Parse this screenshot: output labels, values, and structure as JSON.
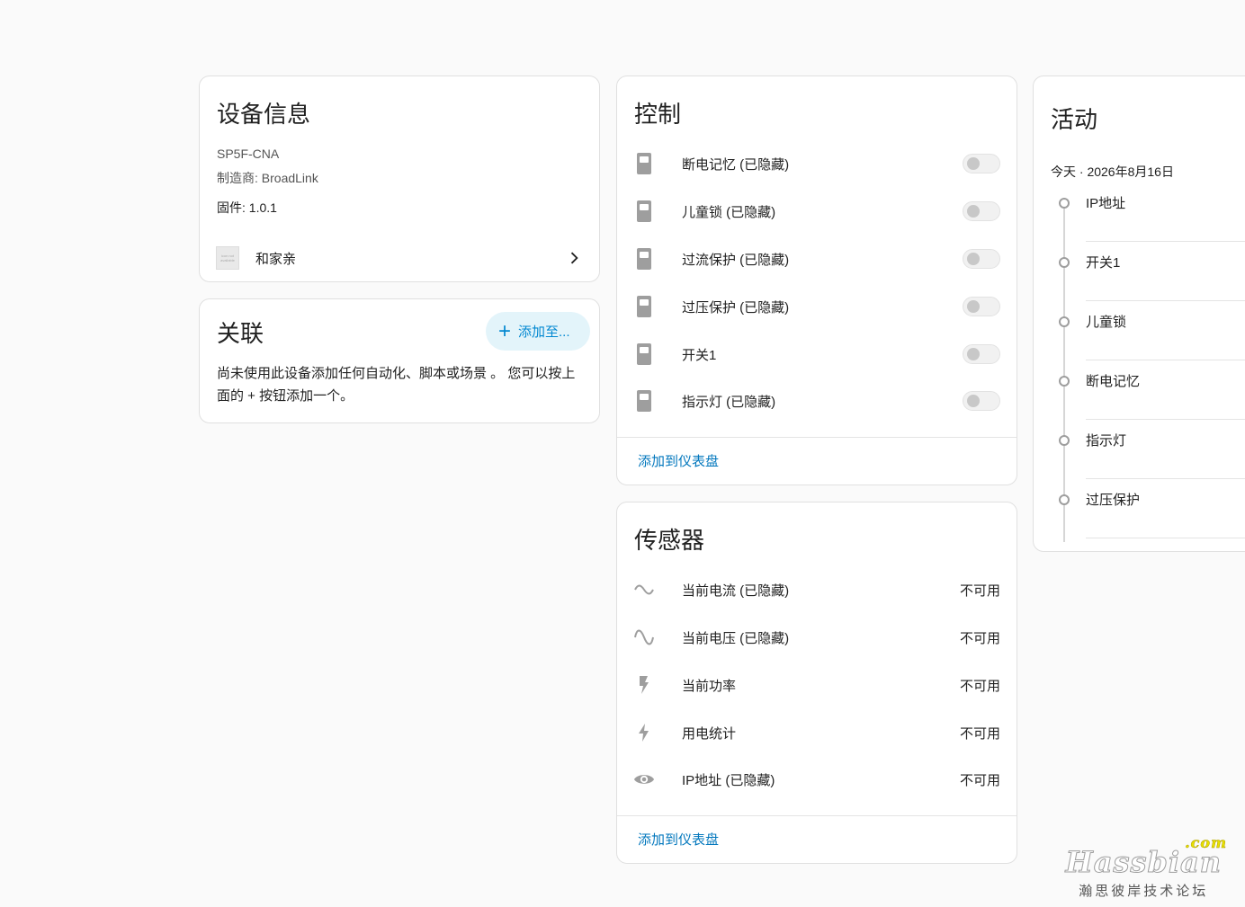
{
  "device_info": {
    "title": "设备信息",
    "model": "SP5F-CNA",
    "manufacturer": "制造商: BroadLink",
    "firmware": "固件: 1.0.1",
    "area_thumb_text": "icon not available",
    "area": "和家亲"
  },
  "related": {
    "title": "关联",
    "add_button": "添加至...",
    "text": "尚未使用此设备添加任何自动化、脚本或场景 。 您可以按上面的 + 按钮添加一个。"
  },
  "controls": {
    "title": "控制",
    "items": [
      {
        "name": "断电记忆 (已隐藏)"
      },
      {
        "name": "儿童锁 (已隐藏)"
      },
      {
        "name": "过流保护 (已隐藏)"
      },
      {
        "name": "过压保护 (已隐藏)"
      },
      {
        "name": "开关1"
      },
      {
        "name": "指示灯 (已隐藏)"
      }
    ],
    "footer_link": "添加到仪表盘"
  },
  "sensors": {
    "title": "传感器",
    "items": [
      {
        "name": "当前电流 (已隐藏)",
        "state": "不可用",
        "icon": "current-ac-icon"
      },
      {
        "name": "当前电压 (已隐藏)",
        "state": "不可用",
        "icon": "sine-wave-icon"
      },
      {
        "name": "当前功率",
        "state": "不可用",
        "icon": "flash-icon"
      },
      {
        "name": "用电统计",
        "state": "不可用",
        "icon": "lightning-bolt-icon"
      },
      {
        "name": "IP地址 (已隐藏)",
        "state": "不可用",
        "icon": "eye-icon"
      }
    ],
    "footer_link": "添加到仪表盘"
  },
  "activity": {
    "title": "活动",
    "date": "今天 · 2026年8月16日",
    "items": [
      "IP地址",
      "开关1",
      "儿童锁",
      "断电记忆",
      "指示灯",
      "过压保护"
    ]
  },
  "watermark": {
    "main": "Hassbian",
    "com": ".com",
    "sub": "瀚思彼岸技术论坛"
  },
  "colors": {
    "accent": "#0288d1",
    "link": "#0277bd",
    "add_button_bg": "#e3f4fa",
    "icon_gray": "#9e9e9e"
  }
}
